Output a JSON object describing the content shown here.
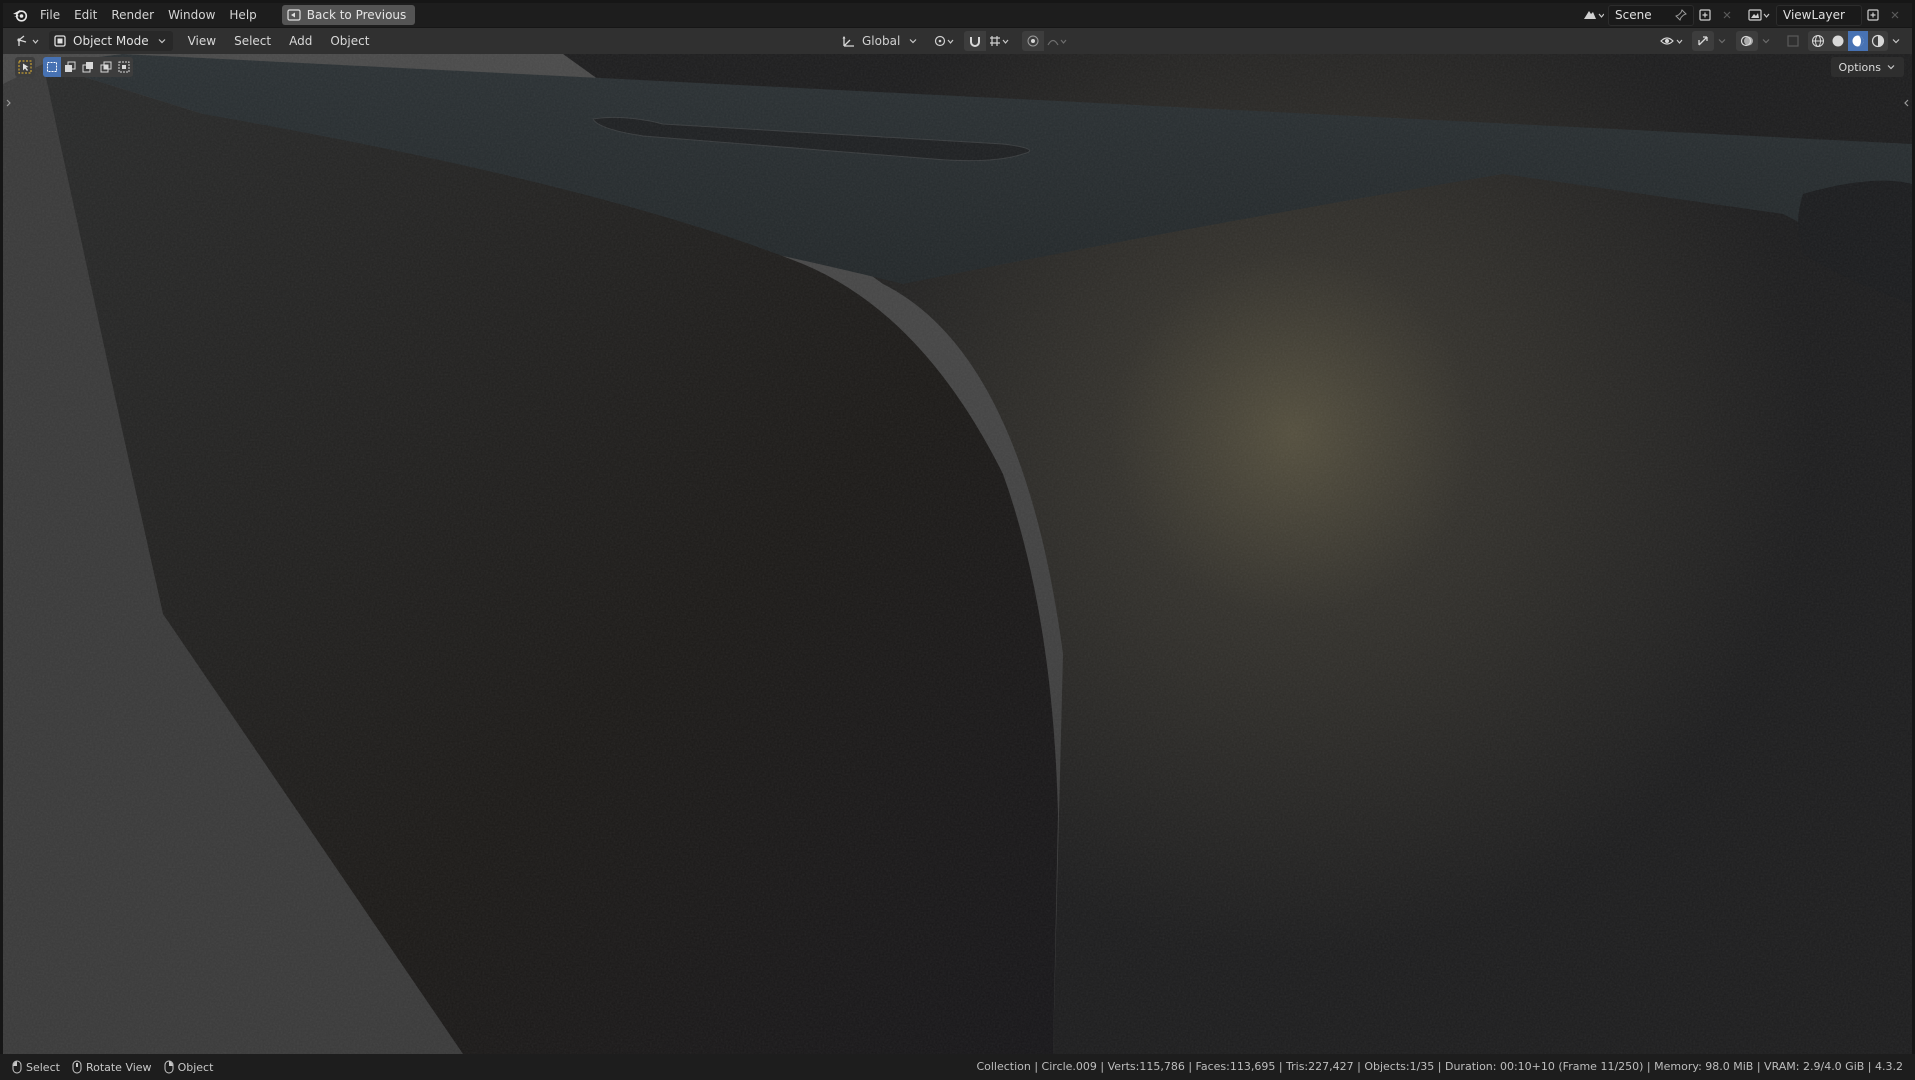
{
  "topbar": {
    "menus": [
      "File",
      "Edit",
      "Render",
      "Window",
      "Help"
    ],
    "back_button": "Back to Previous",
    "scene": "Scene",
    "view_layer": "ViewLayer"
  },
  "viewport_header": {
    "mode": "Object Mode",
    "menus": [
      "View",
      "Select",
      "Add",
      "Object"
    ],
    "transform_orientation": "Global",
    "options_label": "Options"
  },
  "statusbar": {
    "hints": [
      "Select",
      "Rotate View",
      "Object"
    ],
    "info": "Collection | Circle.009 | Verts:115,786 | Faces:113,695 | Tris:227,427 | Objects:1/35 | Duration: 00:10+10 (Frame 11/250) | Memory: 98.0 MiB | VRAM: 2.9/4.0 GiB | 4.3.2"
  },
  "colors": {
    "accent_blue": "#4772b3",
    "panel_dark": "#1d1d1d",
    "header": "#303030",
    "background_grey": "#474747"
  },
  "icons": [
    "blender-logo-icon",
    "back-icon",
    "scene-icon",
    "pin-icon",
    "new-scene-icon",
    "viewlayer-icon",
    "editor-type-icon",
    "object-mode-icon",
    "orientation-icon",
    "pivot-icon",
    "snap-icon",
    "proportional-icon",
    "visibility-icon",
    "gizmo-icon",
    "overlay-icon",
    "xray-icon",
    "wireframe-icon",
    "solid-icon",
    "material-preview-icon",
    "rendered-icon",
    "select-tool-icon",
    "mouse-left-icon",
    "mouse-middle-icon",
    "mouse-right-icon"
  ]
}
